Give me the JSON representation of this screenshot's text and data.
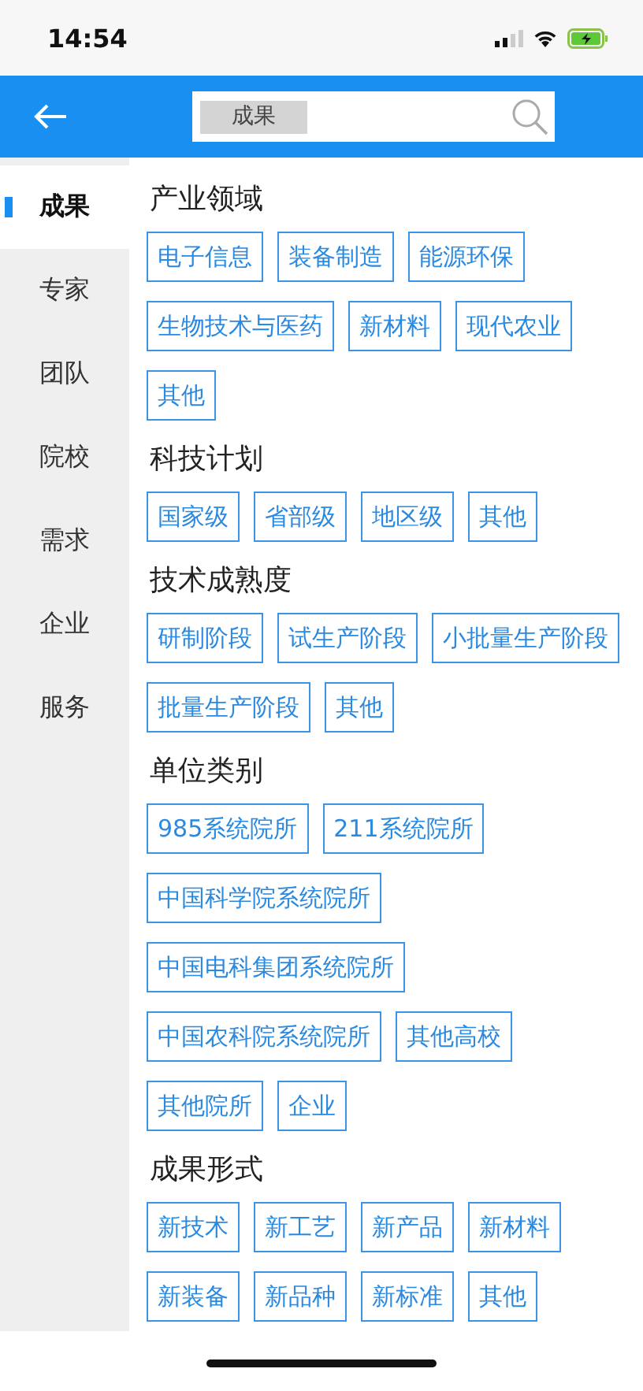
{
  "status_bar": {
    "time": "14:54"
  },
  "search": {
    "value": "成果"
  },
  "sidebar": {
    "items": [
      {
        "label": "成果",
        "selected": true
      },
      {
        "label": "专家",
        "selected": false
      },
      {
        "label": "团队",
        "selected": false
      },
      {
        "label": "院校",
        "selected": false
      },
      {
        "label": "需求",
        "selected": false
      },
      {
        "label": "企业",
        "selected": false
      },
      {
        "label": "服务",
        "selected": false
      }
    ]
  },
  "sections": [
    {
      "title": "产业领域",
      "tags": [
        "电子信息",
        "装备制造",
        "能源环保",
        "生物技术与医药",
        "新材料",
        "现代农业",
        "其他"
      ]
    },
    {
      "title": "科技计划",
      "tags": [
        "国家级",
        "省部级",
        "地区级",
        "其他"
      ]
    },
    {
      "title": "技术成熟度",
      "tags": [
        "研制阶段",
        "试生产阶段",
        "小批量生产阶段",
        "批量生产阶段",
        "其他"
      ]
    },
    {
      "title": "单位类别",
      "tags": [
        "985系统院所",
        "211系统院所",
        "中国科学院系统院所",
        "中国电科集团系统院所",
        "中国农科院系统院所",
        "其他高校",
        "其他院所",
        "企业"
      ]
    },
    {
      "title": "成果形式",
      "tags": [
        "新技术",
        "新工艺",
        "新产品",
        "新材料",
        "新装备",
        "新品种",
        "新标准",
        "其他"
      ]
    }
  ]
}
